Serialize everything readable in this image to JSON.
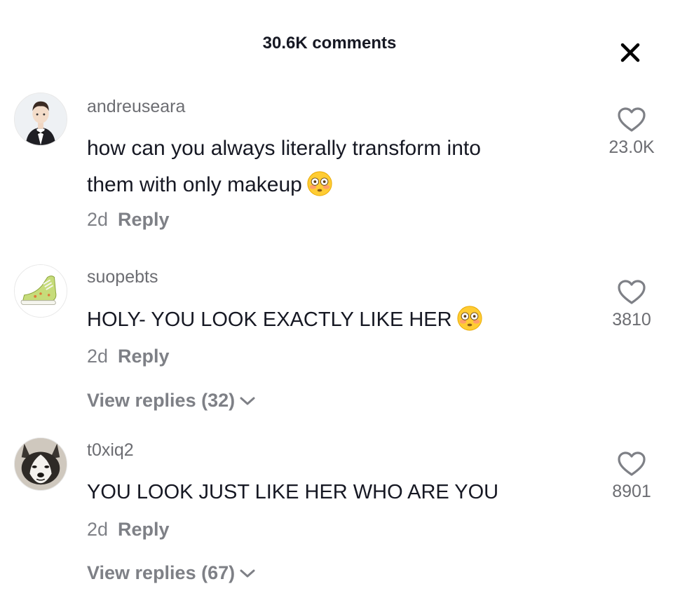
{
  "header": {
    "title": "30.6K comments",
    "close_icon": "close-icon"
  },
  "comments": [
    {
      "username": "andreuseara",
      "text_line1": "how can you always literally transform into",
      "text_line2": "them with only makeup",
      "emoji": "flushed-face-emoji",
      "age": "2d",
      "reply_label": "Reply",
      "likes": "23.0K",
      "avatar": "man-in-tuxedo-avatar"
    },
    {
      "username": "suopebts",
      "text": "HOLY- YOU LOOK EXACTLY LIKE HER",
      "emoji": "flushed-face-emoji",
      "age": "2d",
      "reply_label": "Reply",
      "view_replies": "View replies (32)",
      "likes": "3810",
      "avatar": "sneaker-avatar"
    },
    {
      "username": "t0xiq2",
      "text": "YOU LOOK JUST LIKE HER WHO ARE YOU",
      "age": "2d",
      "reply_label": "Reply",
      "view_replies": "View replies (67)",
      "likes": "8901",
      "avatar": "husky-dog-avatar"
    }
  ],
  "colors": {
    "text_primary": "#161823",
    "text_secondary": "#6c6d72",
    "background": "#ffffff"
  }
}
